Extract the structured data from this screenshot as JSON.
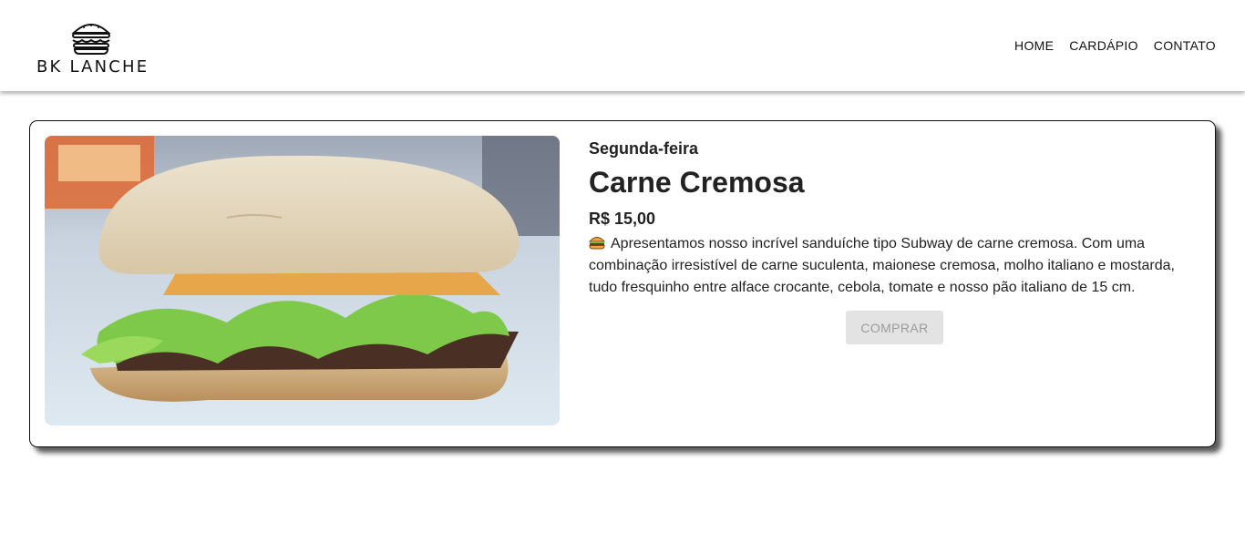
{
  "brand": {
    "logo_text": "BK LANCHE"
  },
  "nav": {
    "items": [
      "HOME",
      "CARDÁPIO",
      "CONTATO"
    ]
  },
  "product": {
    "day": "Segunda-feira",
    "name": "Carne Cremosa",
    "price": "R$ 15,00",
    "description": "Apresentamos nosso incrível sanduíche tipo Subway de carne cremosa. Com uma combinação irresistível de carne suculenta, maionese cremosa, molho italiano e mostarda, tudo fresquinho entre alface crocante, cebola, tomate e nosso pão italiano de 15 cm.",
    "description_icon": "burger-emoji-icon",
    "buy_label": "COMPRAR",
    "image_subject": "sandwich-photo"
  },
  "colors": {
    "card_border": "#111111",
    "button_bg": "#e3e3e3",
    "button_text": "#9b9b9b"
  }
}
